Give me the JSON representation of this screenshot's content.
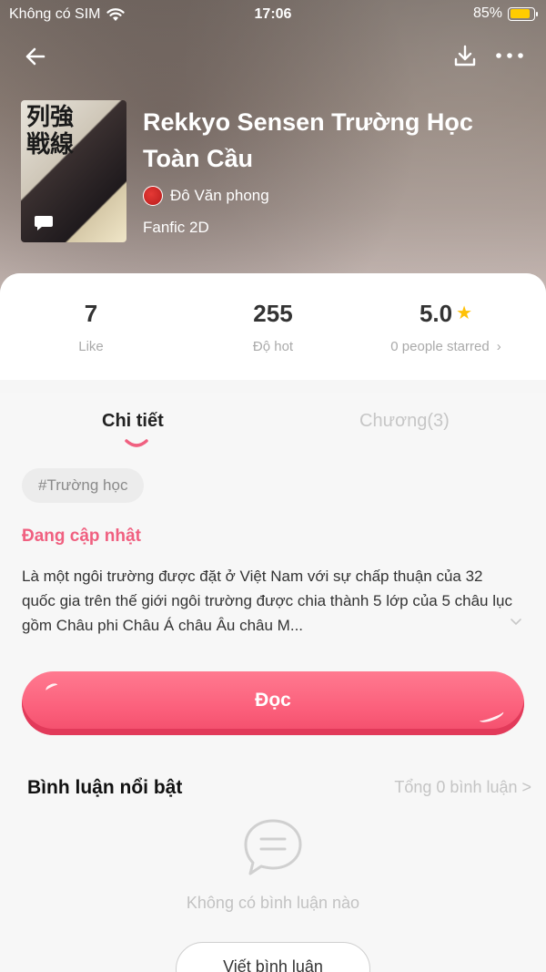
{
  "status_bar": {
    "carrier": "Không có SIM",
    "time": "17:06",
    "battery": "85%"
  },
  "book": {
    "title": "Rekkyo Sensen Trường Học Toàn Cầu",
    "author": "Đô Văn phong",
    "genre": "Fanfic 2D",
    "cover_text": "列強戦線"
  },
  "stats": [
    {
      "value": "7",
      "label": "Like"
    },
    {
      "value": "255",
      "label": "Độ hot"
    },
    {
      "value": "5.0",
      "label": "0 people starred"
    }
  ],
  "tabs": [
    {
      "label": "Chi tiết",
      "active": true
    },
    {
      "label": "Chương(3)",
      "active": false
    }
  ],
  "tag": "#Trường học",
  "update_status": "Đang cập nhật",
  "description": "Là một ngôi trường được đặt ở Việt Nam với sự chấp thuận của 32 quốc gia trên thế giới ngôi trường được chia thành 5 lớp của 5 châu lục gồm Châu phi Châu Á châu Âu châu M...",
  "read_button": "Đọc",
  "comments": {
    "title": "Bình luận nổi bật",
    "total": "Tổng 0 bình luận >",
    "empty": "Không có bình luận nào",
    "write_button": "Viết bình luận"
  },
  "colors": {
    "accent": "#fb5f7b",
    "status": "#f06080",
    "star": "#ffc107"
  }
}
